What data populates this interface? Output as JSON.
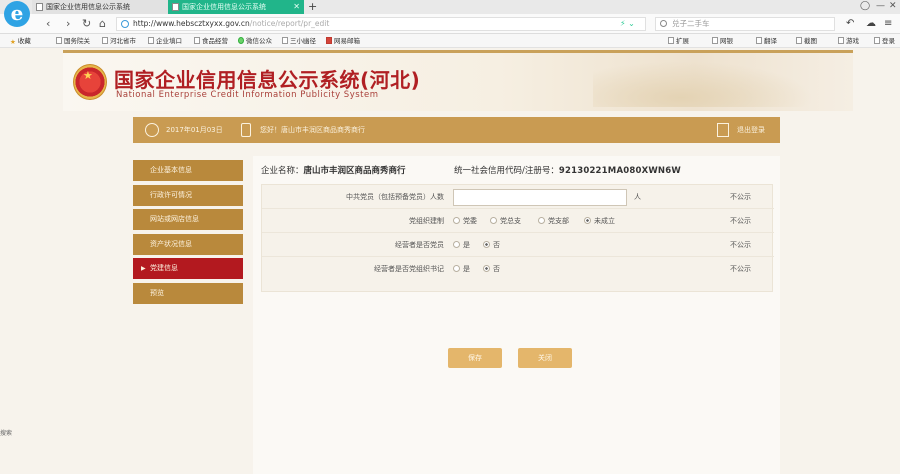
{
  "browser": {
    "tabs": [
      {
        "label": "国家企业信用信息公示系统"
      },
      {
        "label": "国家企业信用信息公示系统"
      }
    ],
    "url_main": "http://www.hebscztxyxx.gov.cn",
    "url_rest": "/notice/report/pr_edit",
    "search_placeholder": "兑子二手车",
    "bookmarks": [
      "收藏",
      "国务院关",
      "河北省市",
      "企业填口",
      "食品经营",
      "微信公众",
      "三小幽径",
      "网易邮箱"
    ],
    "right_bookmarks": [
      "扩展",
      "网银",
      "翻译",
      "截图",
      "游戏",
      "登录"
    ]
  },
  "site": {
    "title": "国家企业信用信息公示系统(河北)",
    "subtitle": "National Enterprise Credit Information Publicity System",
    "date": "2017年01月03日",
    "enterprise_line": "您好！唐山市丰润区商品商秀商行",
    "logout": "退出登录"
  },
  "sidebar": {
    "items": [
      {
        "label": "企业基本信息"
      },
      {
        "label": "行政许可情况"
      },
      {
        "label": "网站或网店信息"
      },
      {
        "label": "资产状况信息"
      },
      {
        "label": "党建信息"
      },
      {
        "label": "预览"
      }
    ]
  },
  "content": {
    "name_label": "企业名称：",
    "name_value": "唐山市丰润区商品商秀商行",
    "credit_label": "统一社会信用代码/注册号：",
    "credit_value": "92130221MA080XWN6W",
    "rows": [
      {
        "label": "中共党员（包括预备党员）人数",
        "unit": "人",
        "publicity": "不公示"
      },
      {
        "label": "党组织建制",
        "options": [
          "党委",
          "党总支",
          "党支部",
          "未成立"
        ],
        "selected": "未成立",
        "publicity": "不公示"
      },
      {
        "label": "经营者是否党员",
        "options": [
          "是",
          "否"
        ],
        "selected": "否",
        "publicity": "不公示"
      },
      {
        "label": "经营者是否党组织书记",
        "options": [
          "是",
          "否"
        ],
        "selected": "否",
        "publicity": "不公示"
      }
    ],
    "save_label": "保存",
    "close_label": "关闭"
  },
  "side_panel": {
    "label": "搜索"
  }
}
